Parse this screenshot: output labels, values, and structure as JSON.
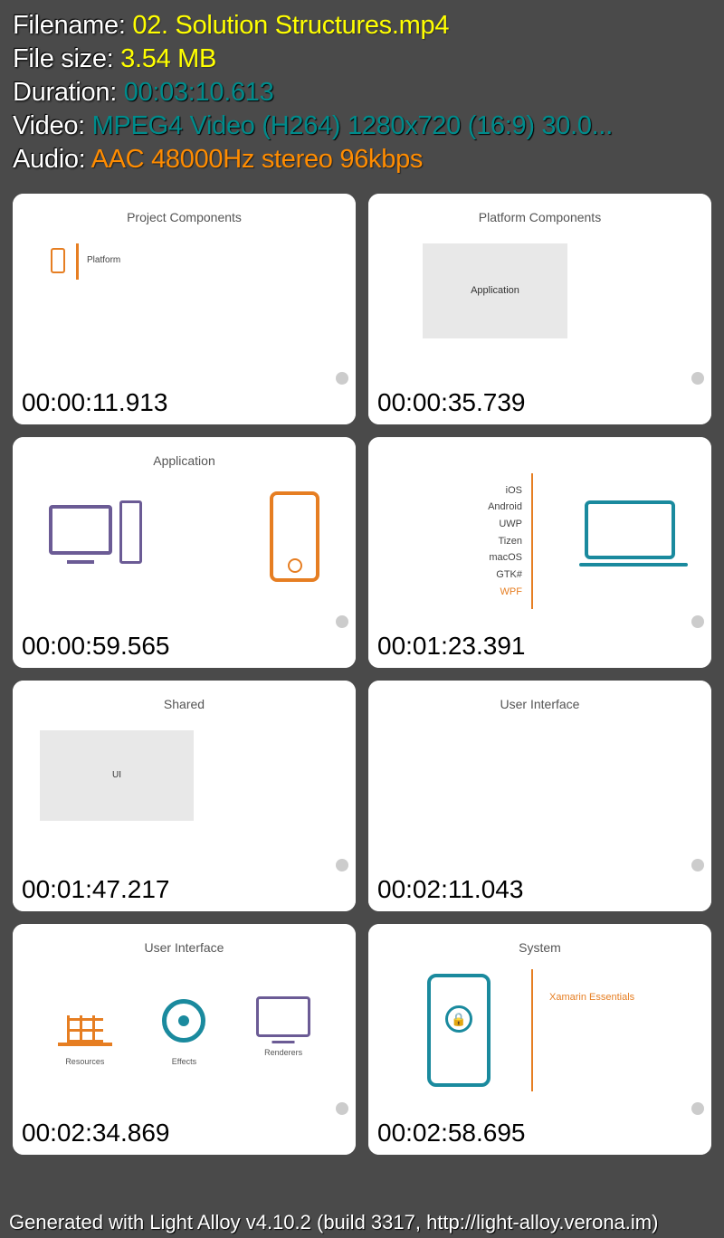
{
  "meta": {
    "filename_label": "Filename: ",
    "filename_value": "02. Solution Structures.mp4",
    "filesize_label": "File size: ",
    "filesize_value": "3.54 MB",
    "duration_label": "Duration: ",
    "duration_value": "00:03:10.613",
    "video_label": "Video: ",
    "video_value": "MPEG4 Video (H264) 1280x720 (16:9) 30.0...",
    "audio_label": "Audio: ",
    "audio_value": "AAC 48000Hz stereo 96kbps"
  },
  "thumbs": {
    "t1": {
      "title": "Project Components",
      "inner_label": "Platform",
      "time": "00:00:11.913"
    },
    "t2": {
      "title": "Platform Components",
      "inner_label": "Application",
      "time": "00:00:35.739"
    },
    "t3": {
      "title": "Application",
      "time": "00:00:59.565"
    },
    "t4": {
      "list": {
        "l1": "iOS",
        "l2": "Android",
        "l3": "UWP",
        "l4": "Tizen",
        "l5": "macOS",
        "l6": "GTK#",
        "l7": "WPF"
      },
      "time": "00:01:23.391"
    },
    "t5": {
      "title": "Shared",
      "inner_label": "UI",
      "time": "00:01:47.217"
    },
    "t6": {
      "title": "User Interface",
      "time": "00:02:11.043"
    },
    "t7": {
      "title": "User Interface",
      "items": {
        "i1": "Resources",
        "i2": "Effects",
        "i3": "Renderers"
      },
      "time": "00:02:34.869"
    },
    "t8": {
      "title": "System",
      "label": "Xamarin Essentials",
      "time": "00:02:58.695"
    }
  },
  "footer": "Generated with Light Alloy v4.10.2 (build 3317, http://light-alloy.verona.im)"
}
